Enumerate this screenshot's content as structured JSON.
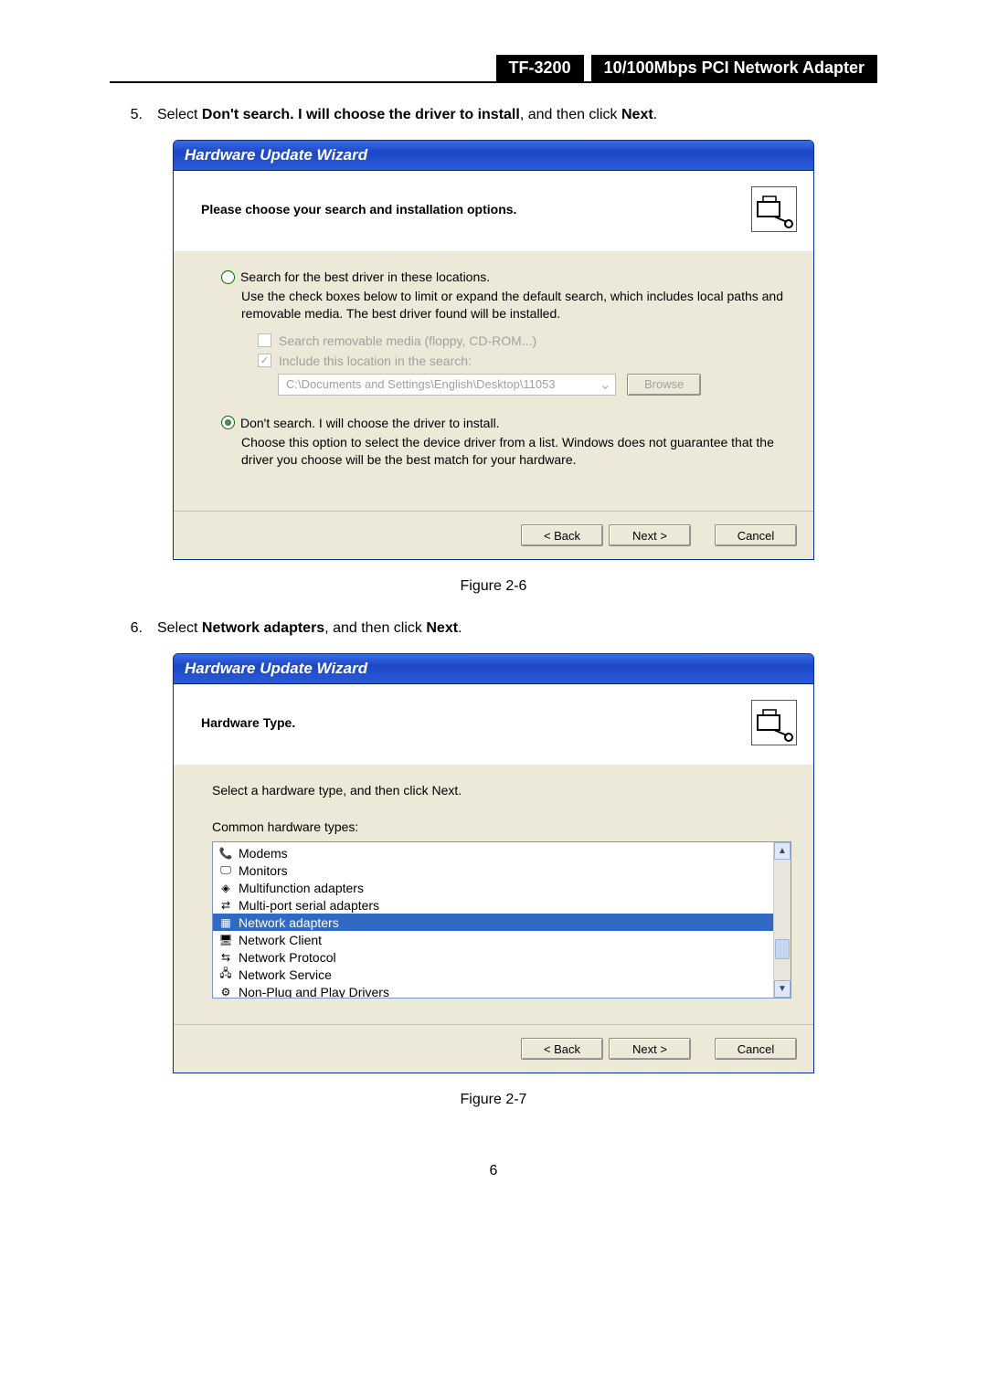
{
  "header": {
    "model": "TF-3200",
    "desc": "10/100Mbps PCI Network Adapter"
  },
  "step5": {
    "num": "5.",
    "text_a": "Select ",
    "text_b": "Don't search. I will choose the driver to install",
    "text_c": ", and then click ",
    "text_d": "Next",
    "text_e": "."
  },
  "wizard1": {
    "title": "Hardware Update Wizard",
    "header": "Please choose your search and installation options.",
    "opt1": "Search for the best driver in these locations.",
    "opt1_desc": "Use the check boxes below to limit or expand the default search, which includes local paths and removable media. The best driver found will be installed.",
    "chk1": "Search removable media (floppy, CD-ROM...)",
    "chk2": "Include this location in the search:",
    "path": "C:\\Documents and Settings\\English\\Desktop\\11053",
    "browse": "Browse",
    "opt2": "Don't search. I will choose the driver to install.",
    "opt2_desc": "Choose this option to select the device driver from a list.  Windows does not guarantee that the driver you choose will be the best match for your hardware.",
    "back": "< Back",
    "next": "Next >",
    "cancel": "Cancel"
  },
  "figure1": "Figure 2-6",
  "step6": {
    "num": "6.",
    "text_a": "Select ",
    "text_b": "Network adapters",
    "text_c": ", and then click ",
    "text_d": "Next",
    "text_e": "."
  },
  "wizard2": {
    "title": "Hardware Update Wizard",
    "header": "Hardware Type.",
    "prompt": "Select a hardware type, and then click Next.",
    "listLabel": "Common hardware types:",
    "items": [
      "Modems",
      "Monitors",
      "Multifunction adapters",
      "Multi-port serial adapters",
      "Network adapters",
      "Network Client",
      "Network Protocol",
      "Network Service",
      "Non-Plug and Play Drivers"
    ],
    "back": "< Back",
    "next": "Next >",
    "cancel": "Cancel"
  },
  "figure2": "Figure 2-7",
  "pageNumber": "6"
}
